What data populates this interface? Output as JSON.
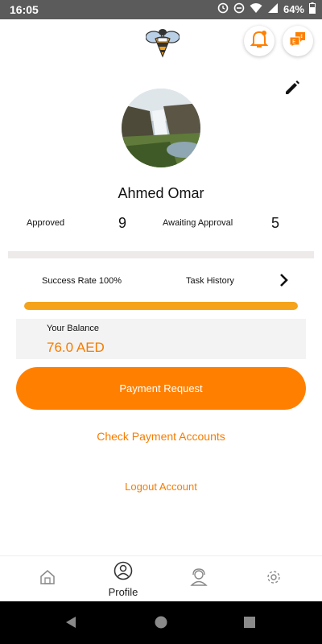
{
  "status_bar": {
    "time": "16:05",
    "battery": "64%"
  },
  "profile": {
    "name": "Ahmed Omar"
  },
  "stats": {
    "approved_label": "Approved",
    "approved_value": "9",
    "awaiting_label": "Awaiting Approval",
    "awaiting_value": "5"
  },
  "performance": {
    "success_rate": "Success Rate 100%",
    "success_fraction": 1.0,
    "task_history": "Task History"
  },
  "balance": {
    "label": "Your Balance",
    "value": "76.0 AED"
  },
  "actions": {
    "payment_request": "Payment Request",
    "check_accounts": "Check Payment Accounts",
    "logout": "Logout Account"
  },
  "bottom_nav": {
    "profile_label": "Profile"
  },
  "colors": {
    "accent": "#ff8000",
    "accent_text": "#f57c00",
    "progress": "#f5a31a"
  }
}
